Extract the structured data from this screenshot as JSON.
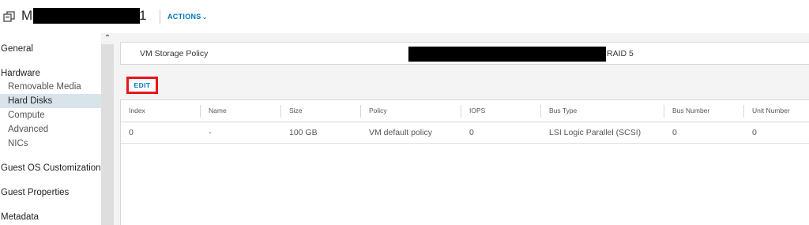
{
  "header": {
    "title_start": "M",
    "title_end": "1",
    "actions_label": "ACTIONS",
    "actions_chevron": "⌄"
  },
  "sidebar": {
    "items": [
      {
        "label": "General",
        "level": "top"
      },
      {
        "label": "Hardware",
        "level": "top"
      },
      {
        "label": "Removable Media",
        "level": "sub"
      },
      {
        "label": "Hard Disks",
        "level": "sub",
        "selected": true
      },
      {
        "label": "Compute",
        "level": "sub"
      },
      {
        "label": "Advanced",
        "level": "sub"
      },
      {
        "label": "NICs",
        "level": "sub"
      },
      {
        "label": "Guest OS Customization",
        "level": "top"
      },
      {
        "label": "Guest Properties",
        "level": "top"
      },
      {
        "label": "Metadata",
        "level": "top"
      }
    ],
    "scroll_up_glyph": "⌃"
  },
  "policy": {
    "label": "VM Storage Policy",
    "value_suffix": "RAID 5"
  },
  "edit_label": "EDIT",
  "table": {
    "headers": [
      "Index",
      "Name",
      "Size",
      "Policy",
      "IOPS",
      "Bus Type",
      "Bus Number",
      "Unit Number"
    ],
    "rows": [
      [
        "0",
        "-",
        "100 GB",
        "VM default policy",
        "0",
        "LSI Logic Parallel (SCSI)",
        "0",
        "0"
      ]
    ]
  },
  "colors": {
    "accent": "#0079b8",
    "highlight_border": "#e8161b",
    "selected_bg": "#d9e4ea",
    "redaction": "#000000"
  }
}
